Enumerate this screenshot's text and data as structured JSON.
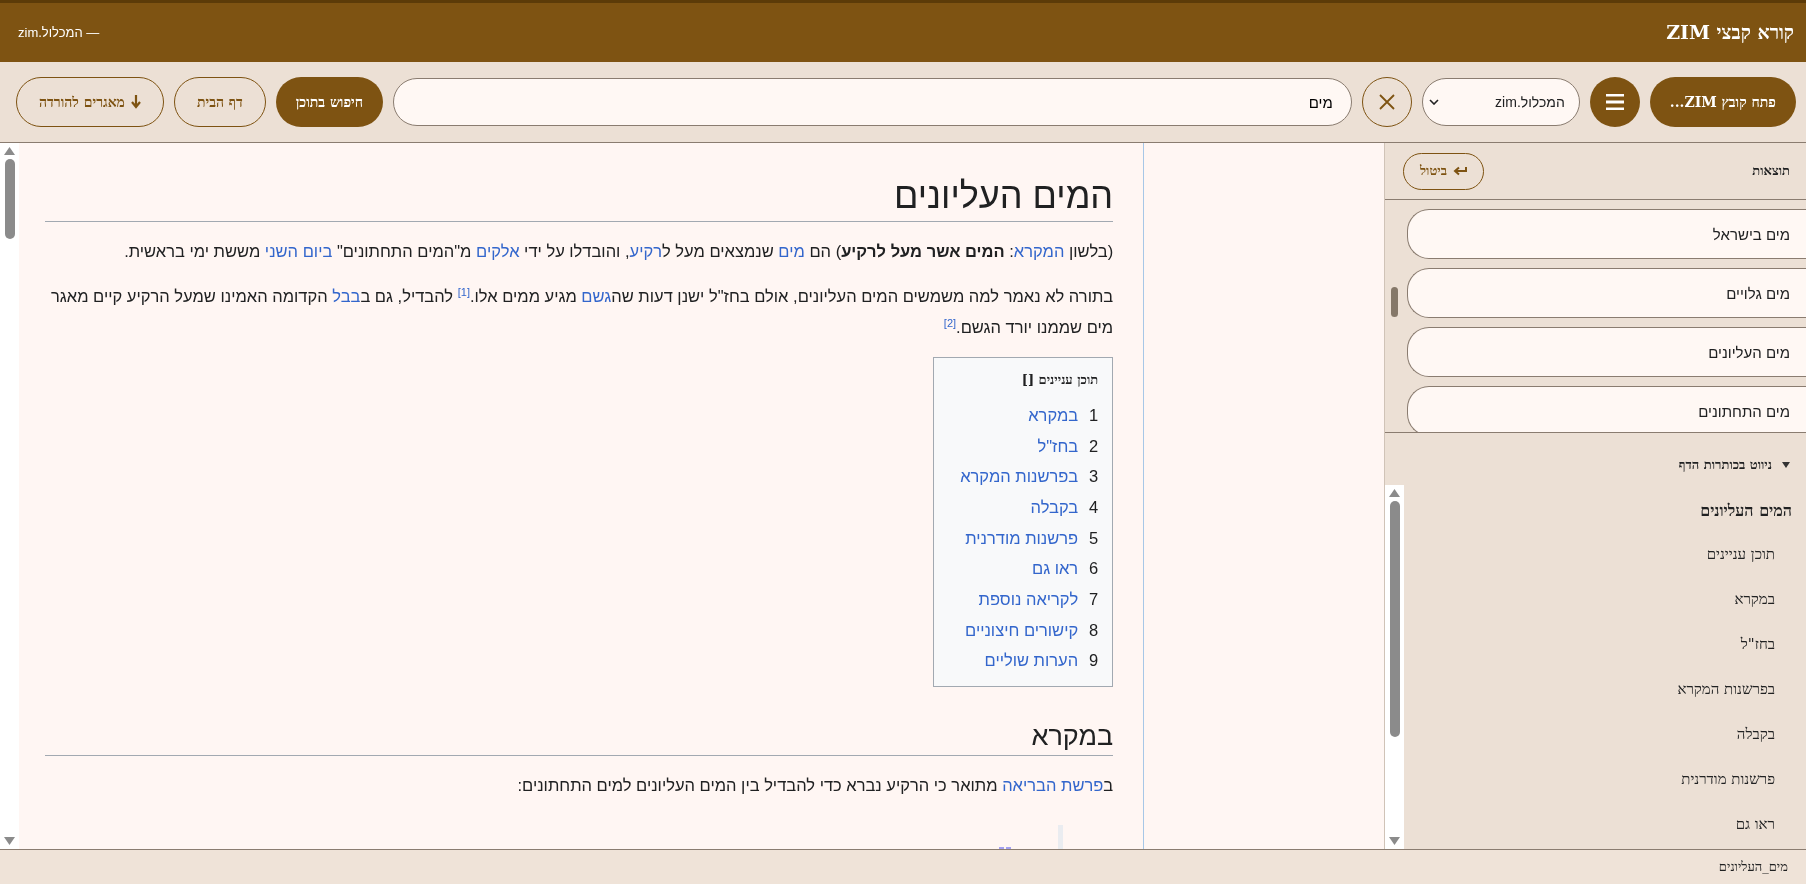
{
  "header": {
    "title": "קורא קבצי ZIM",
    "subtitle": "— המכלול.zim"
  },
  "toolbar": {
    "open_button": "פתח קובץ ZIM...",
    "library_select": "המכלול.zim",
    "search_value": "מים",
    "search_button": "חיפוש בתוכן",
    "home_button": "דף הבית",
    "downloads_button": "מאגרים להורדה"
  },
  "article": {
    "title": "המים העליונים",
    "blocks": [
      {
        "kind": "paragraph",
        "runs": [
          {
            "kind": "text",
            "text": "(בלשון "
          },
          {
            "kind": "link",
            "text": "המקרא"
          },
          {
            "kind": "text",
            "text": ": "
          },
          {
            "kind": "bold",
            "text": "המים אשר מעל לרקיע"
          },
          {
            "kind": "text",
            "text": ") הם "
          },
          {
            "kind": "link",
            "text": "מים"
          },
          {
            "kind": "text",
            "text": " שנמצאים מעל ל"
          },
          {
            "kind": "link",
            "text": "רקיע"
          },
          {
            "kind": "text",
            "text": ", והובדלו על ידי "
          },
          {
            "kind": "link",
            "text": "אלקים"
          },
          {
            "kind": "text",
            "text": " מ\"המים התחתונים\" "
          },
          {
            "kind": "link",
            "text": "ביום השני"
          },
          {
            "kind": "text",
            "text": " מששת ימי בראשית."
          }
        ]
      },
      {
        "kind": "paragraph",
        "runs": [
          {
            "kind": "text",
            "text": "בתורה לא נאמר למה משמשים המים העליונים, אולם בחז\"ל ישנן דעות שה"
          },
          {
            "kind": "link",
            "text": "גשם"
          },
          {
            "kind": "text",
            "text": " מגיע ממים אלו."
          },
          {
            "kind": "ref",
            "text": "[1]"
          },
          {
            "kind": "text",
            "text": " להבדיל, גם ב"
          },
          {
            "kind": "link",
            "text": "בבל"
          },
          {
            "kind": "text",
            "text": " הקדומה האמינו שמעל הרקיע קיים מאגר מים שממנו יורד הגשם."
          },
          {
            "kind": "ref",
            "text": "[2]"
          }
        ]
      },
      {
        "kind": "toc",
        "title": "תוכן עניינים []",
        "items": [
          {
            "number": "1",
            "label": "במקרא"
          },
          {
            "number": "2",
            "label": "בחז\"ל"
          },
          {
            "number": "3",
            "label": "בפרשנות המקרא"
          },
          {
            "number": "4",
            "label": "בקבלה"
          },
          {
            "number": "5",
            "label": "פרשנות מודרנית"
          },
          {
            "number": "6",
            "label": "ראו גם"
          },
          {
            "number": "7",
            "label": "לקריאה נוספת"
          },
          {
            "number": "8",
            "label": "קישורים חיצוניים"
          },
          {
            "number": "9",
            "label": "הערות שוליים"
          }
        ]
      },
      {
        "kind": "heading",
        "text": "במקרא"
      },
      {
        "kind": "paragraph",
        "runs": [
          {
            "kind": "text",
            "text": "ב"
          },
          {
            "kind": "link",
            "text": "פרשת הבריאה"
          },
          {
            "kind": "text",
            "text": " מתואר כי הרקיע נברא כדי להבדיל בין המים העליונים למים התחתונים:"
          }
        ]
      },
      {
        "kind": "quote"
      }
    ]
  },
  "sidebar": {
    "results_title": "תוצאות",
    "cancel_button": "ביטול",
    "results": [
      "מים בישראל",
      "מים גלויים",
      "מים העליונים",
      "מים התחתונים"
    ],
    "nav": {
      "title": "ניווט בכותרות הדף",
      "expanded": true,
      "items": [
        {
          "label": "המים העליונים",
          "children": [
            {
              "label": "תוכן עניינים"
            },
            {
              "label": "במקרא"
            },
            {
              "label": "בחז\"ל"
            },
            {
              "label": "בפרשנות המקרא"
            },
            {
              "label": "בקבלה"
            },
            {
              "label": "פרשנות מודרנית"
            },
            {
              "label": "ראו גם"
            }
          ]
        }
      ]
    }
  },
  "status_bar": {
    "text": "מים_העליונים"
  }
}
